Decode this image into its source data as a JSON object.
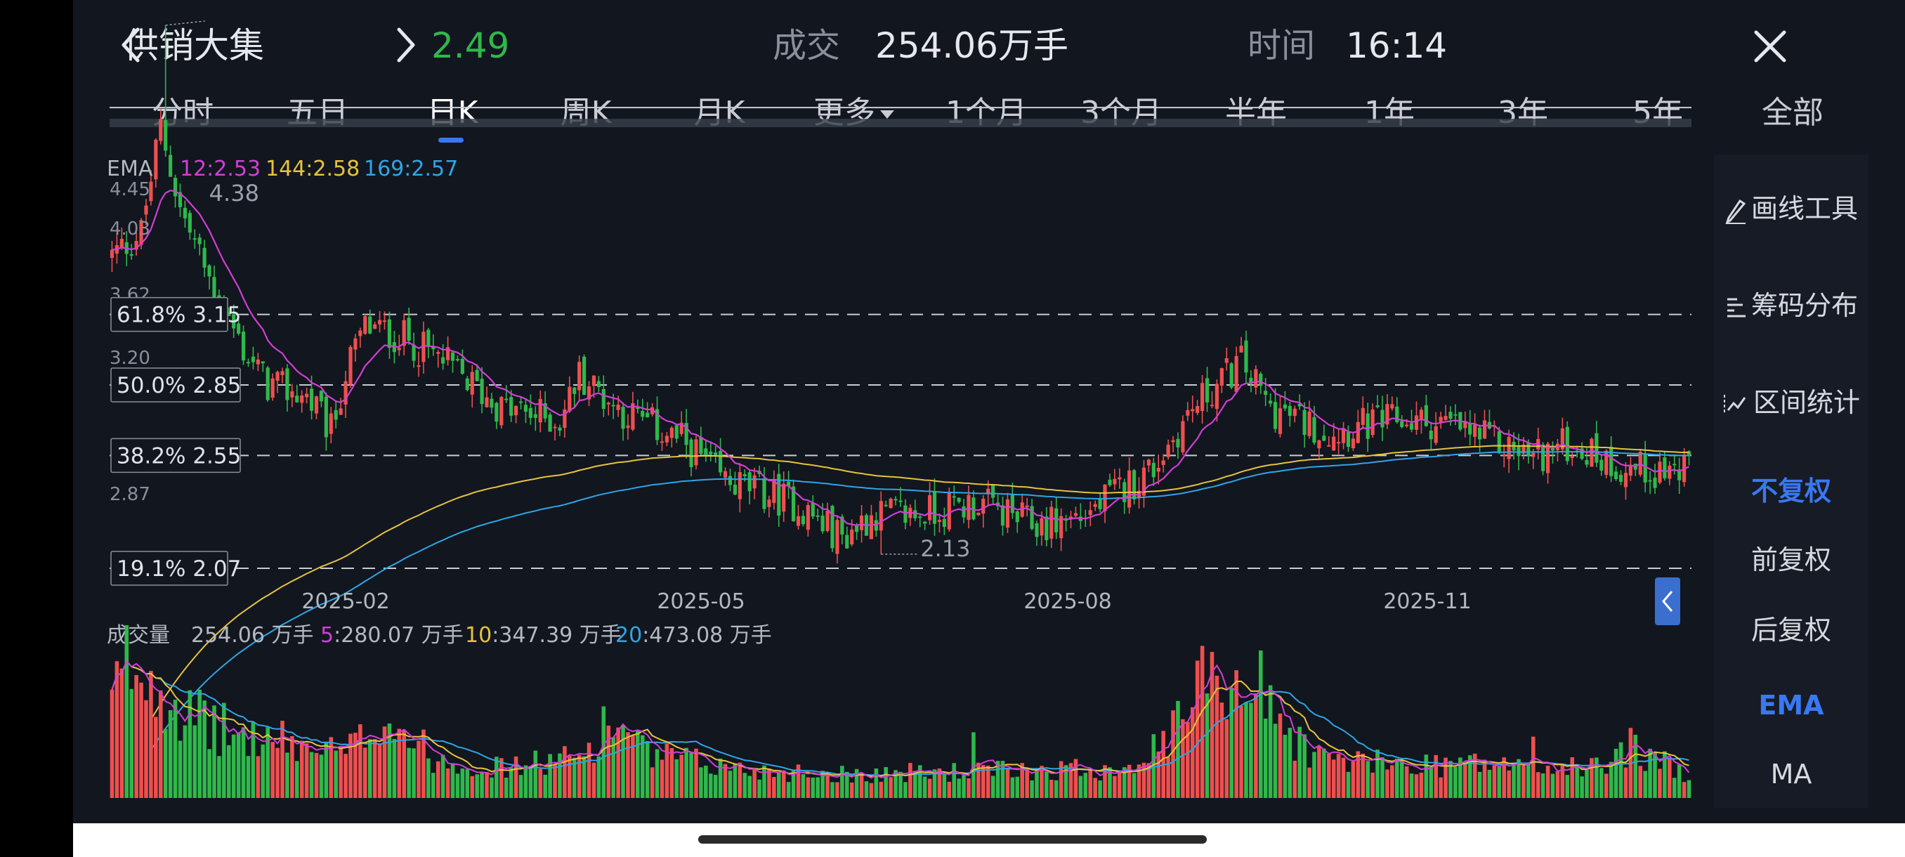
{
  "header": {
    "title": "供销大集",
    "price": "2.49",
    "volume_label": "成交",
    "volume_value": "254.06万手",
    "time_label": "时间",
    "time_value": "16:14"
  },
  "tabs": [
    "分时",
    "五日",
    "日K",
    "周K",
    "月K",
    "更多",
    "1个月",
    "3个月",
    "半年",
    "1年",
    "3年",
    "5年",
    "全部"
  ],
  "active_tab": "日K",
  "side_tools": [
    "画线工具",
    "筹码分布",
    "区间统计"
  ],
  "side_adjust": [
    "不复权",
    "前复权",
    "后复权"
  ],
  "side_indicators": [
    "EMA",
    "MA"
  ],
  "selected_adjust": "不复权",
  "selected_indicator": "EMA",
  "colors": {
    "up": "#ef4f4f",
    "down": "#2fb84b",
    "ema12": "#d13fd3",
    "ema144": "#e6c33d",
    "ema169": "#2ea6e6",
    "vol_ma5": "#d13fd3",
    "vol_ma10": "#e6c33d",
    "vol_ma20": "#2ea6e6",
    "accent": "#3a78f2"
  },
  "chart_data": {
    "type": "candlestick",
    "ema_legend": {
      "label": "EMA",
      "items": [
        {
          "name": "12",
          "text": "12:2.53",
          "value": 2.53
        },
        {
          "name": "144",
          "text": "144:2.58",
          "value": 2.58
        },
        {
          "name": "169",
          "text": "169:2.57",
          "value": 2.57
        }
      ]
    },
    "price_axis_labels": [
      "4.45",
      "4.03",
      "3.62",
      "3.20",
      "2.87"
    ],
    "high_label": "4.38",
    "low_label": "2.13",
    "fib_levels": [
      {
        "label": "61.8% 3.15",
        "value": 3.15
      },
      {
        "label": "50.0% 2.85",
        "value": 2.85
      },
      {
        "label": "38.2% 2.55",
        "value": 2.55
      },
      {
        "label": "19.1% 2.07",
        "value": 2.07
      }
    ],
    "hlines": [
      4.03
    ],
    "x_ticks": [
      "2025-02",
      "2025-05",
      "2025-08",
      "2025-11"
    ],
    "price_points": [
      [
        0,
        3.4
      ],
      [
        6,
        3.5
      ],
      [
        10,
        3.95
      ],
      [
        14,
        3.6
      ],
      [
        20,
        3.3
      ],
      [
        27,
        3.0
      ],
      [
        32,
        2.85
      ],
      [
        40,
        2.8
      ],
      [
        45,
        2.65
      ],
      [
        48,
        2.9
      ],
      [
        52,
        3.1
      ],
      [
        60,
        3.05
      ],
      [
        68,
        2.95
      ],
      [
        80,
        2.75
      ],
      [
        92,
        2.7
      ],
      [
        96,
        2.9
      ],
      [
        104,
        2.75
      ],
      [
        118,
        2.6
      ],
      [
        125,
        2.45
      ],
      [
        140,
        2.35
      ],
      [
        150,
        2.2
      ],
      [
        156,
        2.3
      ],
      [
        165,
        2.3
      ],
      [
        178,
        2.35
      ],
      [
        190,
        2.25
      ],
      [
        200,
        2.3
      ],
      [
        214,
        2.5
      ],
      [
        222,
        2.75
      ],
      [
        232,
        2.95
      ],
      [
        238,
        2.75
      ],
      [
        250,
        2.65
      ],
      [
        264,
        2.7
      ],
      [
        275,
        2.68
      ],
      [
        282,
        2.62
      ],
      [
        292,
        2.55
      ],
      [
        300,
        2.6
      ],
      [
        310,
        2.5
      ],
      [
        324,
        2.48
      ]
    ],
    "volume_legend": {
      "label": "成交量",
      "items": [
        {
          "name": "current",
          "text": "254.06 万手"
        },
        {
          "name": "5",
          "text": "5:280.07 万手"
        },
        {
          "name": "10",
          "text": "10:347.39 万手"
        },
        {
          "name": "20",
          "text": "20:473.08 万手"
        }
      ]
    },
    "volume_points": [
      [
        0,
        700
      ],
      [
        3,
        1000
      ],
      [
        10,
        880
      ],
      [
        16,
        600
      ],
      [
        26,
        460
      ],
      [
        34,
        420
      ],
      [
        48,
        320
      ],
      [
        56,
        620
      ],
      [
        66,
        300
      ],
      [
        80,
        220
      ],
      [
        96,
        300
      ],
      [
        102,
        560
      ],
      [
        110,
        320
      ],
      [
        130,
        210
      ],
      [
        150,
        180
      ],
      [
        170,
        190
      ],
      [
        190,
        210
      ],
      [
        206,
        220
      ],
      [
        216,
        380
      ],
      [
        225,
        900
      ],
      [
        234,
        850
      ],
      [
        240,
        530
      ],
      [
        248,
        300
      ],
      [
        262,
        250
      ],
      [
        280,
        260
      ],
      [
        292,
        220
      ],
      [
        304,
        220
      ],
      [
        312,
        380
      ],
      [
        318,
        260
      ],
      [
        324,
        180
      ]
    ],
    "volume_spikes": [
      [
        226,
        1000
      ],
      [
        236,
        1010
      ],
      [
        105,
        500
      ],
      [
        312,
        480
      ],
      [
        177,
        450
      ],
      [
        292,
        420
      ]
    ]
  }
}
